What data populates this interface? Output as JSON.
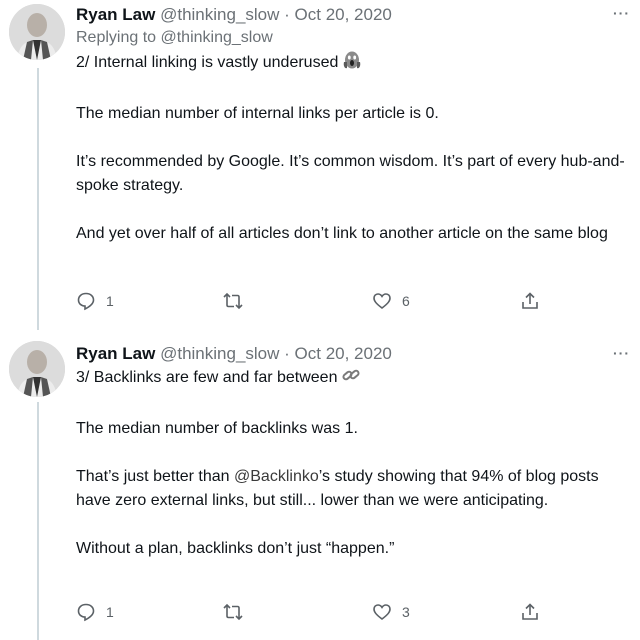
{
  "tweets": [
    {
      "name": "Ryan Law",
      "handle": "@thinking_slow",
      "separator": " · ",
      "date": "Oct 20, 2020",
      "more": "···",
      "replying_to": "Replying to @thinking_slow",
      "headline": "2/ Internal linking is vastly underused",
      "headline_emoji": "scream-emoji",
      "paragraphs": [
        "The median number of internal links per article is 0.",
        "It’s recommended by Google. It’s common wisdom. It’s part of every hub-and-spoke strategy.",
        "And yet over half of all articles don’t link to another article on the same blog"
      ],
      "actions": {
        "reply_count": "1",
        "retweet_count": "",
        "like_count": "6"
      }
    },
    {
      "name": "Ryan Law",
      "handle": "@thinking_slow",
      "separator": " · ",
      "date": "Oct 20, 2020",
      "more": "···",
      "headline": "3/ Backlinks are few and far between",
      "headline_emoji": "link-emoji",
      "paragraphs": {
        "p1": "The median number of backlinks was 1.",
        "p2_mention": "@Backlinko",
        "p2_before": "That’s just better than ",
        "p2_after": "’s study showing that 94% of blog posts have zero external links, but still... lower than we were anticipating.",
        "p3": "Without a plan, backlinks don’t just “happen.”"
      },
      "actions": {
        "reply_count": "1",
        "retweet_count": "",
        "like_count": "3"
      }
    }
  ],
  "icons": [
    "reply-icon",
    "retweet-icon",
    "like-icon",
    "share-icon",
    "more-icon"
  ]
}
